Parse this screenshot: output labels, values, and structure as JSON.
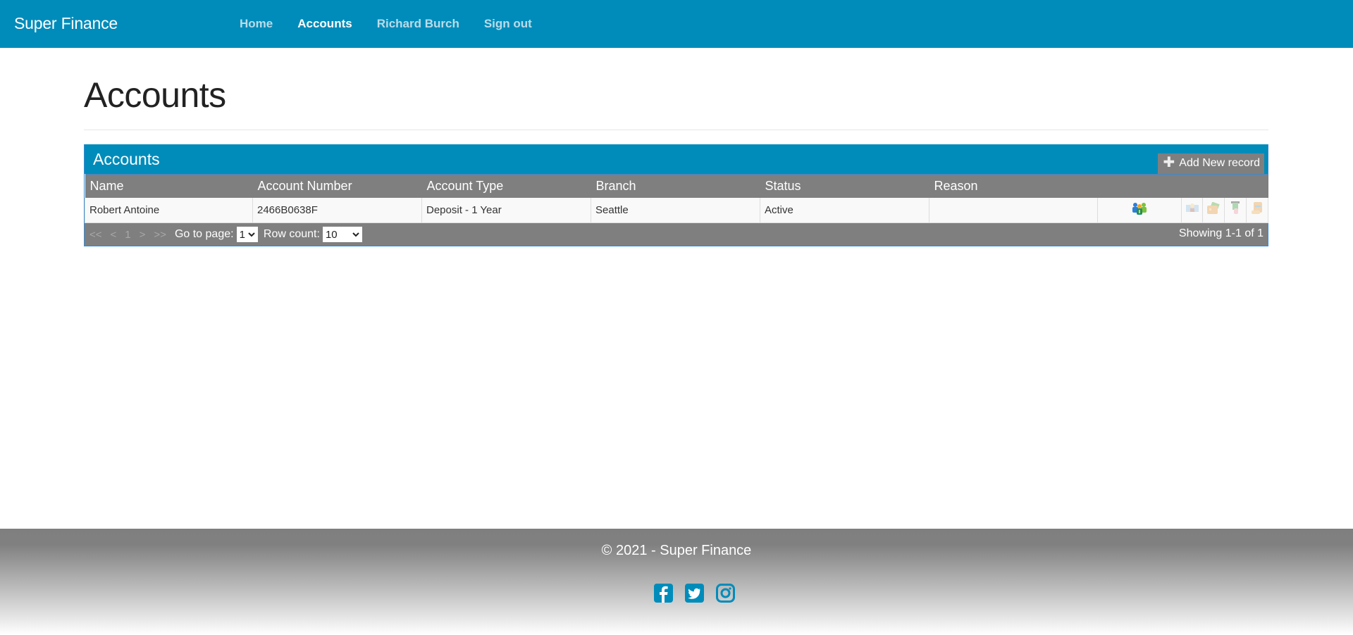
{
  "navbar": {
    "brand": "Super Finance",
    "links": [
      {
        "label": "Home",
        "active": false
      },
      {
        "label": "Accounts",
        "active": true
      },
      {
        "label": "Richard Burch",
        "active": false
      },
      {
        "label": "Sign out",
        "active": false
      }
    ],
    "color": "#008cba"
  },
  "page": {
    "title": "Accounts"
  },
  "table": {
    "title": "Accounts",
    "add_button": "Add New record",
    "columns": [
      "Name",
      "Account Number",
      "Account Type",
      "Branch",
      "Status",
      "Reason"
    ],
    "rows": [
      {
        "name": "Robert Antoine",
        "account_number": "2466B0638F",
        "account_type": "Deposit - 1 Year",
        "branch": "Seattle",
        "status": "Active",
        "reason": "",
        "actions": [
          "customers-icon",
          "bank-icon",
          "wallet-icon",
          "atm-card-icon",
          "statement-scroll-icon"
        ]
      }
    ],
    "pager": {
      "first": "<<",
      "prev": "<",
      "current_page": "1",
      "next": ">",
      "last": ">>",
      "goto_label": "Go to page:",
      "goto_value": "1",
      "rowcount_label": "Row count:",
      "rowcount_value": "10",
      "showing": "Showing 1-1 of 1"
    }
  },
  "footer": {
    "copyright": "© 2021 - Super Finance",
    "social": [
      "facebook-icon",
      "twitter-icon",
      "instagram-icon"
    ]
  }
}
